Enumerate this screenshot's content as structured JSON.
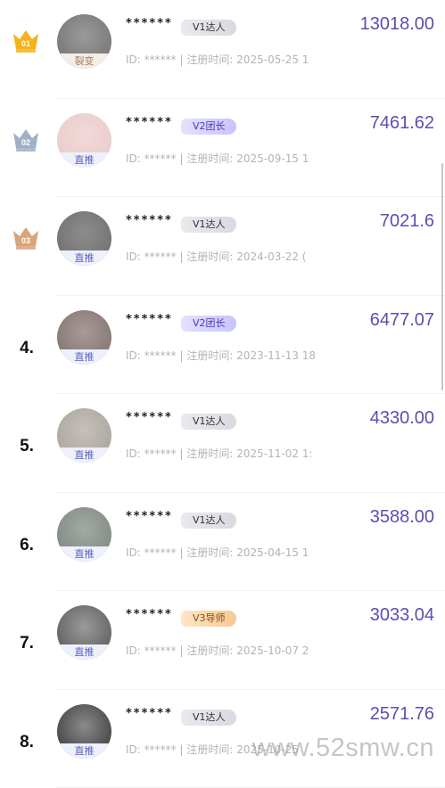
{
  "colors": {
    "amount": "#5a4fb0",
    "crown_gold": "#f6b21a",
    "crown_silver": "#9fb0c8",
    "crown_bronze": "#d8a47c"
  },
  "rows": [
    {
      "rank": "01",
      "rank_style": "crown-gold",
      "name": "******",
      "level": "V1达人",
      "level_style": "lv-v1",
      "tag": "裂变",
      "tag_style": "split",
      "id_label": "ID:",
      "id_value": "******",
      "sep": "|",
      "time_label": "注册时间:",
      "time_value": "2025-05-25 1",
      "amount": "13018.00"
    },
    {
      "rank": "02",
      "rank_style": "crown-silver",
      "name": "******",
      "level": "V2团长",
      "level_style": "lv-v2",
      "tag": "直推",
      "tag_style": "direct",
      "id_label": "ID:",
      "id_value": "******",
      "sep": "|",
      "time_label": "注册时间:",
      "time_value": "2025-09-15 1",
      "amount": "7461.62"
    },
    {
      "rank": "03",
      "rank_style": "crown-bronze",
      "name": "******",
      "level": "V1达人",
      "level_style": "lv-v1",
      "tag": "直推",
      "tag_style": "direct",
      "id_label": "ID:",
      "id_value": "******",
      "sep": "|",
      "time_label": "注册时间:",
      "time_value": "2024-03-22 (",
      "amount": "7021.6"
    },
    {
      "rank": "4.",
      "rank_style": "number",
      "name": "******",
      "level": "V2团长",
      "level_style": "lv-v2",
      "tag": "直推",
      "tag_style": "direct",
      "id_label": "ID:",
      "id_value": "******",
      "sep": "|",
      "time_label": "注册时间:",
      "time_value": "2023-11-13 18",
      "amount": "6477.07"
    },
    {
      "rank": "5.",
      "rank_style": "number",
      "name": "******",
      "level": "V1达人",
      "level_style": "lv-v1",
      "tag": "直推",
      "tag_style": "direct",
      "id_label": "ID:",
      "id_value": "******",
      "sep": "|",
      "time_label": "注册时间:",
      "time_value": "2025-11-02 1:",
      "amount": "4330.00"
    },
    {
      "rank": "6.",
      "rank_style": "number",
      "name": "******",
      "level": "V1达人",
      "level_style": "lv-v1",
      "tag": "直推",
      "tag_style": "direct",
      "id_label": "ID:",
      "id_value": "******",
      "sep": "|",
      "time_label": "注册时间:",
      "time_value": "2025-04-15 1",
      "amount": "3588.00"
    },
    {
      "rank": "7.",
      "rank_style": "number",
      "name": "******",
      "level": "V3导师",
      "level_style": "lv-v3",
      "tag": "直推",
      "tag_style": "direct",
      "id_label": "ID:",
      "id_value": "******",
      "sep": "|",
      "time_label": "注册时间:",
      "time_value": "2025-10-07 2",
      "amount": "3033.04"
    },
    {
      "rank": "8.",
      "rank_style": "number",
      "name": "******",
      "level": "V1达人",
      "level_style": "lv-v1",
      "tag": "直推",
      "tag_style": "direct",
      "id_label": "ID:",
      "id_value": "******",
      "sep": "|",
      "time_label": "注册时间:",
      "time_value": "2025-10-25",
      "amount": "2571.76"
    }
  ],
  "watermark": "www.52smw.cn"
}
